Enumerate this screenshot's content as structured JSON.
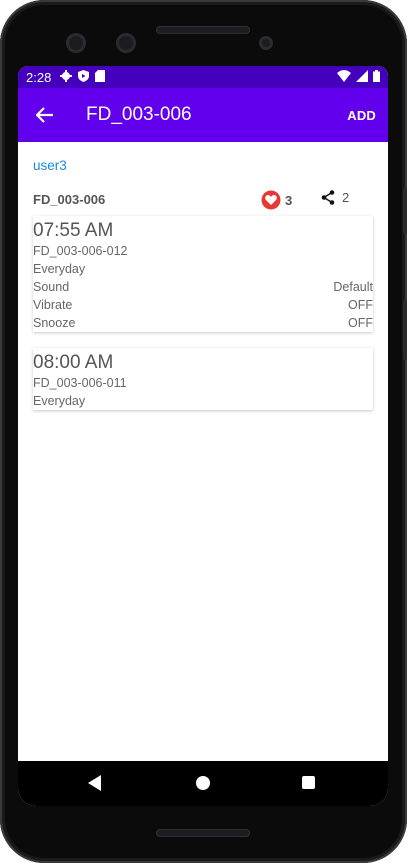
{
  "status_bar": {
    "time": "2:28",
    "left_icons": [
      "gear-icon",
      "shield-icon",
      "sd-card-icon"
    ],
    "right_icons": [
      "wifi-icon",
      "signal-icon",
      "battery-icon"
    ]
  },
  "app_bar": {
    "title": "FD_003-006",
    "action_label": "ADD"
  },
  "user_link": "user3",
  "group": {
    "title": "FD_003-006",
    "likes": "3",
    "shares": "2"
  },
  "alarms": [
    {
      "time": "07:55 AM",
      "name": "FD_003-006-012",
      "repeat": "Everyday",
      "sound_label": "Sound",
      "sound_value": "Default",
      "vibrate_label": "Vibrate",
      "vibrate_value": "OFF",
      "snooze_label": "Snooze",
      "snooze_value": "OFF"
    },
    {
      "time": "08:00 AM",
      "name": "FD_003-006-011",
      "repeat": "Everyday"
    }
  ],
  "colors": {
    "status_bar": "#4400bd",
    "app_bar": "#6200ee",
    "link": "#1e88e5",
    "heart": "#e53935"
  }
}
